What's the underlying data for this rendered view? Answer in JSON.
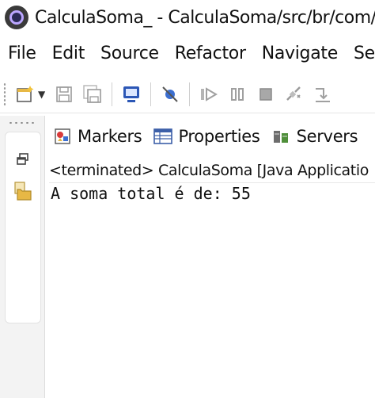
{
  "window": {
    "title": "CalculaSoma_ - CalculaSoma/src/br/com/erick"
  },
  "menubar": {
    "items": [
      "File",
      "Edit",
      "Source",
      "Refactor",
      "Navigate",
      "Sear"
    ]
  },
  "toolbar": {
    "icons": [
      "new-wizard-icon",
      "save-icon",
      "save-all-icon",
      "terminal-icon",
      "debug-skip-icon",
      "resume-icon",
      "suspend-icon",
      "terminate-icon",
      "disconnect-icon",
      "step-into-icon"
    ]
  },
  "views": {
    "tabs": [
      {
        "label": "Markers",
        "icon": "markers-icon"
      },
      {
        "label": "Properties",
        "icon": "properties-icon"
      },
      {
        "label": "Servers",
        "icon": "servers-icon"
      }
    ]
  },
  "console": {
    "status": "<terminated> CalculaSoma [Java Applicatio",
    "output": "A soma total é de: 55"
  },
  "colors": {
    "accent": "#2c57b6",
    "toolbar_icon_gray": "#9a9a9a",
    "folder_yellow": "#e7b845"
  }
}
